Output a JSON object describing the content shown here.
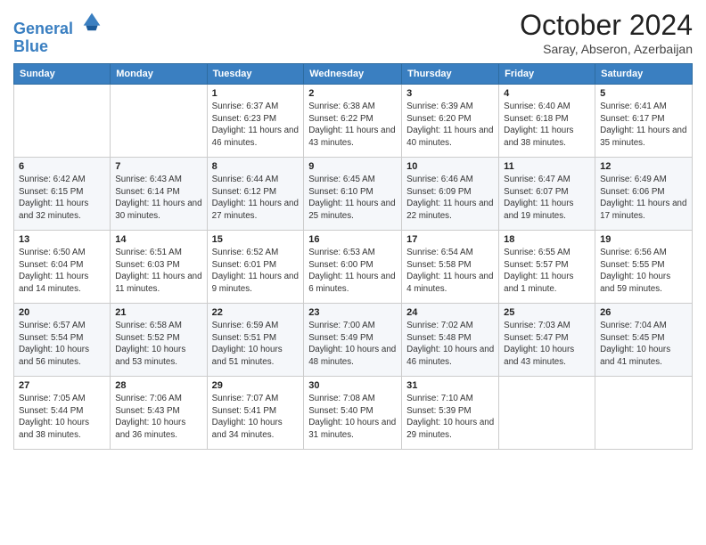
{
  "header": {
    "logo_line1": "General",
    "logo_line2": "Blue",
    "month_title": "October 2024",
    "location": "Saray, Abseron, Azerbaijan"
  },
  "weekdays": [
    "Sunday",
    "Monday",
    "Tuesday",
    "Wednesday",
    "Thursday",
    "Friday",
    "Saturday"
  ],
  "rows": [
    [
      {
        "day": "",
        "sunrise": "",
        "sunset": "",
        "daylight": ""
      },
      {
        "day": "",
        "sunrise": "",
        "sunset": "",
        "daylight": ""
      },
      {
        "day": "1",
        "sunrise": "Sunrise: 6:37 AM",
        "sunset": "Sunset: 6:23 PM",
        "daylight": "Daylight: 11 hours and 46 minutes."
      },
      {
        "day": "2",
        "sunrise": "Sunrise: 6:38 AM",
        "sunset": "Sunset: 6:22 PM",
        "daylight": "Daylight: 11 hours and 43 minutes."
      },
      {
        "day": "3",
        "sunrise": "Sunrise: 6:39 AM",
        "sunset": "Sunset: 6:20 PM",
        "daylight": "Daylight: 11 hours and 40 minutes."
      },
      {
        "day": "4",
        "sunrise": "Sunrise: 6:40 AM",
        "sunset": "Sunset: 6:18 PM",
        "daylight": "Daylight: 11 hours and 38 minutes."
      },
      {
        "day": "5",
        "sunrise": "Sunrise: 6:41 AM",
        "sunset": "Sunset: 6:17 PM",
        "daylight": "Daylight: 11 hours and 35 minutes."
      }
    ],
    [
      {
        "day": "6",
        "sunrise": "Sunrise: 6:42 AM",
        "sunset": "Sunset: 6:15 PM",
        "daylight": "Daylight: 11 hours and 32 minutes."
      },
      {
        "day": "7",
        "sunrise": "Sunrise: 6:43 AM",
        "sunset": "Sunset: 6:14 PM",
        "daylight": "Daylight: 11 hours and 30 minutes."
      },
      {
        "day": "8",
        "sunrise": "Sunrise: 6:44 AM",
        "sunset": "Sunset: 6:12 PM",
        "daylight": "Daylight: 11 hours and 27 minutes."
      },
      {
        "day": "9",
        "sunrise": "Sunrise: 6:45 AM",
        "sunset": "Sunset: 6:10 PM",
        "daylight": "Daylight: 11 hours and 25 minutes."
      },
      {
        "day": "10",
        "sunrise": "Sunrise: 6:46 AM",
        "sunset": "Sunset: 6:09 PM",
        "daylight": "Daylight: 11 hours and 22 minutes."
      },
      {
        "day": "11",
        "sunrise": "Sunrise: 6:47 AM",
        "sunset": "Sunset: 6:07 PM",
        "daylight": "Daylight: 11 hours and 19 minutes."
      },
      {
        "day": "12",
        "sunrise": "Sunrise: 6:49 AM",
        "sunset": "Sunset: 6:06 PM",
        "daylight": "Daylight: 11 hours and 17 minutes."
      }
    ],
    [
      {
        "day": "13",
        "sunrise": "Sunrise: 6:50 AM",
        "sunset": "Sunset: 6:04 PM",
        "daylight": "Daylight: 11 hours and 14 minutes."
      },
      {
        "day": "14",
        "sunrise": "Sunrise: 6:51 AM",
        "sunset": "Sunset: 6:03 PM",
        "daylight": "Daylight: 11 hours and 11 minutes."
      },
      {
        "day": "15",
        "sunrise": "Sunrise: 6:52 AM",
        "sunset": "Sunset: 6:01 PM",
        "daylight": "Daylight: 11 hours and 9 minutes."
      },
      {
        "day": "16",
        "sunrise": "Sunrise: 6:53 AM",
        "sunset": "Sunset: 6:00 PM",
        "daylight": "Daylight: 11 hours and 6 minutes."
      },
      {
        "day": "17",
        "sunrise": "Sunrise: 6:54 AM",
        "sunset": "Sunset: 5:58 PM",
        "daylight": "Daylight: 11 hours and 4 minutes."
      },
      {
        "day": "18",
        "sunrise": "Sunrise: 6:55 AM",
        "sunset": "Sunset: 5:57 PM",
        "daylight": "Daylight: 11 hours and 1 minute."
      },
      {
        "day": "19",
        "sunrise": "Sunrise: 6:56 AM",
        "sunset": "Sunset: 5:55 PM",
        "daylight": "Daylight: 10 hours and 59 minutes."
      }
    ],
    [
      {
        "day": "20",
        "sunrise": "Sunrise: 6:57 AM",
        "sunset": "Sunset: 5:54 PM",
        "daylight": "Daylight: 10 hours and 56 minutes."
      },
      {
        "day": "21",
        "sunrise": "Sunrise: 6:58 AM",
        "sunset": "Sunset: 5:52 PM",
        "daylight": "Daylight: 10 hours and 53 minutes."
      },
      {
        "day": "22",
        "sunrise": "Sunrise: 6:59 AM",
        "sunset": "Sunset: 5:51 PM",
        "daylight": "Daylight: 10 hours and 51 minutes."
      },
      {
        "day": "23",
        "sunrise": "Sunrise: 7:00 AM",
        "sunset": "Sunset: 5:49 PM",
        "daylight": "Daylight: 10 hours and 48 minutes."
      },
      {
        "day": "24",
        "sunrise": "Sunrise: 7:02 AM",
        "sunset": "Sunset: 5:48 PM",
        "daylight": "Daylight: 10 hours and 46 minutes."
      },
      {
        "day": "25",
        "sunrise": "Sunrise: 7:03 AM",
        "sunset": "Sunset: 5:47 PM",
        "daylight": "Daylight: 10 hours and 43 minutes."
      },
      {
        "day": "26",
        "sunrise": "Sunrise: 7:04 AM",
        "sunset": "Sunset: 5:45 PM",
        "daylight": "Daylight: 10 hours and 41 minutes."
      }
    ],
    [
      {
        "day": "27",
        "sunrise": "Sunrise: 7:05 AM",
        "sunset": "Sunset: 5:44 PM",
        "daylight": "Daylight: 10 hours and 38 minutes."
      },
      {
        "day": "28",
        "sunrise": "Sunrise: 7:06 AM",
        "sunset": "Sunset: 5:43 PM",
        "daylight": "Daylight: 10 hours and 36 minutes."
      },
      {
        "day": "29",
        "sunrise": "Sunrise: 7:07 AM",
        "sunset": "Sunset: 5:41 PM",
        "daylight": "Daylight: 10 hours and 34 minutes."
      },
      {
        "day": "30",
        "sunrise": "Sunrise: 7:08 AM",
        "sunset": "Sunset: 5:40 PM",
        "daylight": "Daylight: 10 hours and 31 minutes."
      },
      {
        "day": "31",
        "sunrise": "Sunrise: 7:10 AM",
        "sunset": "Sunset: 5:39 PM",
        "daylight": "Daylight: 10 hours and 29 minutes."
      },
      {
        "day": "",
        "sunrise": "",
        "sunset": "",
        "daylight": ""
      },
      {
        "day": "",
        "sunrise": "",
        "sunset": "",
        "daylight": ""
      }
    ]
  ]
}
